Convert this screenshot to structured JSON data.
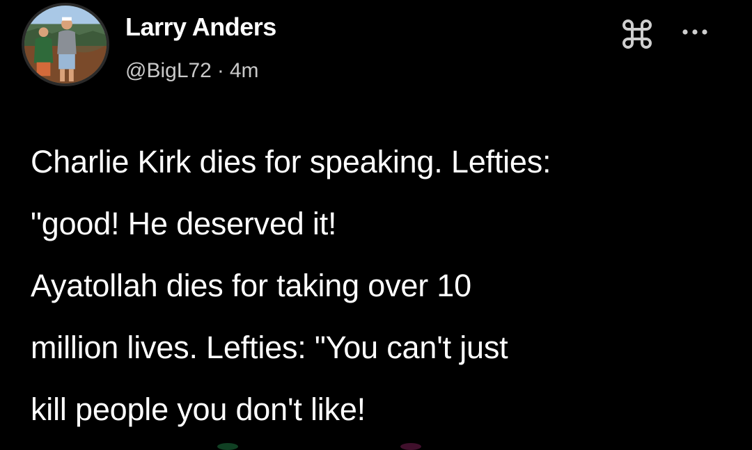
{
  "author": {
    "name": "Larry Anders",
    "handle": "@BigL72",
    "separator": "·",
    "time": "4m"
  },
  "header_icons": {
    "command_icon": "command-key-icon",
    "more_icon": "more-horizontal-icon"
  },
  "post": {
    "lines": [
      "Charlie Kirk dies for speaking. Lefties:",
      "\"good! He deserved it!",
      "Ayatollah dies for taking over 10",
      "million lives. Lefties: \"You can't just",
      "kill people you don't like!"
    ]
  },
  "colors": {
    "background": "#000000",
    "text": "#ffffff",
    "meta_text": "#c9c9c9"
  }
}
